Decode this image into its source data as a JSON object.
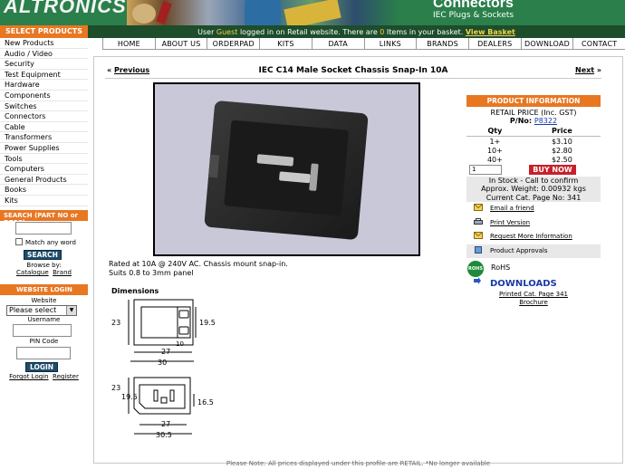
{
  "banner": {
    "logo": "ALTRONICS",
    "category_title": "Connectors",
    "category_subtitle": "IEC Plugs & Sockets"
  },
  "select_products_label": "SELECT PRODUCTS",
  "userbar": {
    "prefix": "User",
    "user": "Guest",
    "middle": "logged in on Retail website.  There are",
    "count": "0",
    "suffix": "Items in your basket.",
    "basket_link": "View Basket"
  },
  "nav": [
    "HOME",
    "ABOUT US",
    "ORDERPAD",
    "KITS",
    "DATA",
    "LINKS",
    "BRANDS",
    "DEALERS",
    "DOWNLOAD",
    "CONTACT"
  ],
  "sidebar": {
    "categories": [
      "New Products",
      "Audio / Video",
      "Security",
      "Test Equipment",
      "Hardware",
      "Components",
      "Switches",
      "Connectors",
      "Cable",
      "Transformers",
      "Power Supplies",
      "Tools",
      "Computers",
      "General Products",
      "Books",
      "Kits"
    ],
    "search_header": "SEARCH (PART NO or DESC)",
    "any_word_label": "Match any word",
    "search_button": "SEARCH",
    "browse_by": "Browse by:",
    "browse_catalogue": "Catalogue",
    "browse_brand": "Brand",
    "login_header": "WEBSITE LOGIN",
    "website_label": "Website",
    "website_select": "Please select",
    "username_label": "Username",
    "pin_label": "PIN Code",
    "login_button": "LOGIN",
    "forgot_login": "Forgot Login",
    "register": "Register"
  },
  "product": {
    "prev": "Previous",
    "next": "Next",
    "title": "IEC C14 Male  Socket Chassis Snap-In 10A",
    "desc_line1": "Rated at 10A @ 240V AC. Chassis mount snap-in.",
    "desc_line2": "Suits 0.8 to 3mm panel",
    "dimensions_label": "Dimensions",
    "dims": {
      "side_height": "23",
      "side_right": "19.5",
      "side_inner": "10",
      "side_width1": "27",
      "side_width2": "30",
      "front_height": "23",
      "front_inner_h": "19.5",
      "front_right": "16.5",
      "front_width1": "27",
      "front_width2": "30.5"
    }
  },
  "info": {
    "header": "PRODUCT INFORMATION",
    "retail": "RETAIL PRICE (Inc. GST)",
    "pno_label": "P/No:",
    "pno": "P8322",
    "price_headers": [
      "Qty",
      "Price"
    ],
    "prices": [
      {
        "qty": "1+",
        "price": "$3.10"
      },
      {
        "qty": "10+",
        "price": "$2.80"
      },
      {
        "qty": "40+",
        "price": "$2.50"
      }
    ],
    "qty_value": "1",
    "buy_now": "BUY NOW",
    "stock": "In Stock - Call to confirm",
    "weight": "Approx. Weight: 0.00932 kgs",
    "cat_page": "Current Cat. Page No: 341",
    "links": [
      "Email a friend",
      "Print Version",
      "Request More Information",
      "Product Approvals"
    ],
    "rohs": "RoHS",
    "rohs_badge": "ROHS",
    "downloads": "DOWNLOADS",
    "printed_cat": "Printed Cat. Page 341",
    "brochure": "Brochure"
  },
  "footer": "Please Note: All prices displayed under this profile are RETAIL. *No longer available",
  "colors": {
    "brand_green": "#2a7f4a",
    "orange": "#e87722",
    "dark_green": "#1d4d2a",
    "buy_red": "#c8202a",
    "link_blue": "#1a3aa6"
  }
}
